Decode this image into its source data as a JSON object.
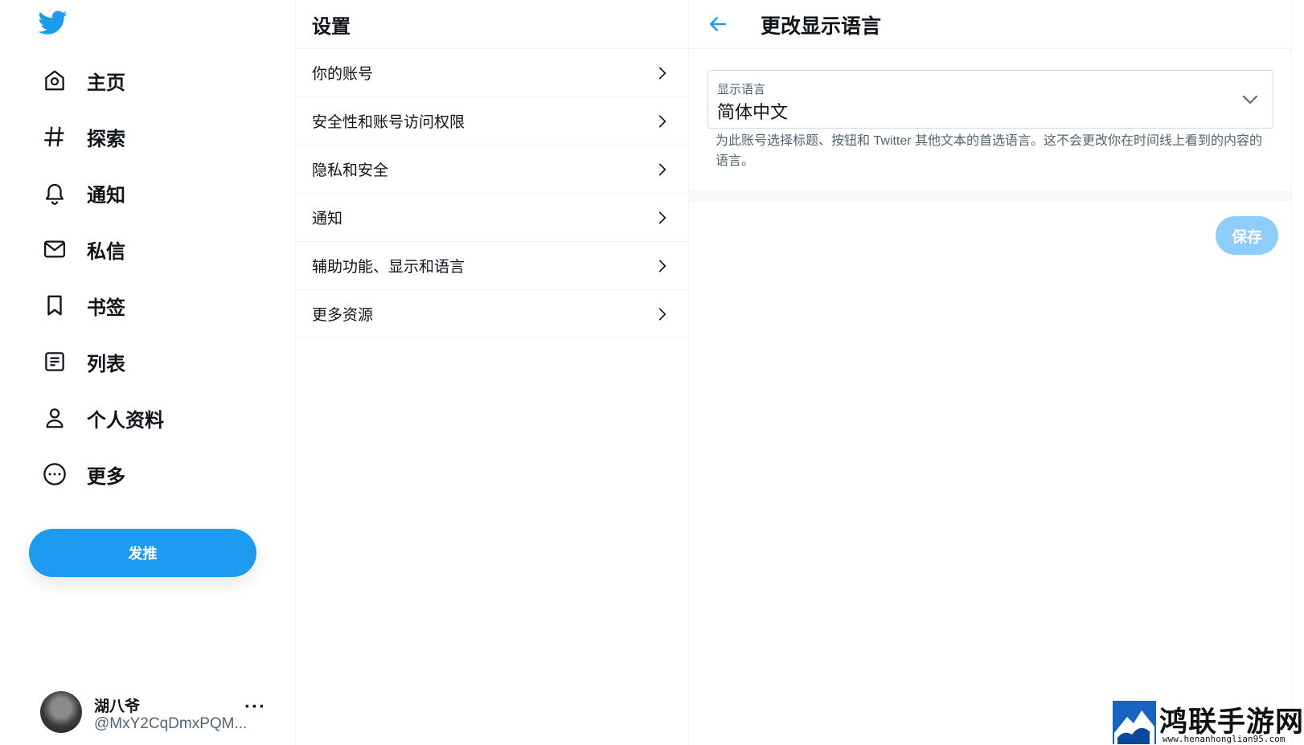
{
  "nav": {
    "items": [
      {
        "label": "主页"
      },
      {
        "label": "探索"
      },
      {
        "label": "通知"
      },
      {
        "label": "私信"
      },
      {
        "label": "书签"
      },
      {
        "label": "列表"
      },
      {
        "label": "个人资料"
      },
      {
        "label": "更多"
      }
    ],
    "tweet_button": "发推"
  },
  "account": {
    "name": "湖八爷",
    "handle": "@MxY2CqDmxPQM...",
    "more": "···"
  },
  "settings": {
    "title": "设置",
    "items": [
      {
        "label": "你的账号"
      },
      {
        "label": "安全性和账号访问权限"
      },
      {
        "label": "隐私和安全"
      },
      {
        "label": "通知"
      },
      {
        "label": "辅助功能、显示和语言"
      },
      {
        "label": "更多资源"
      }
    ]
  },
  "language": {
    "title": "更改显示语言",
    "select_label": "显示语言",
    "select_value": "简体中文",
    "help_text": "为此账号选择标题、按钮和 Twitter 其他文本的首选语言。这不会更改你在时间线上看到的内容的语言。",
    "save_button": "保存"
  },
  "watermark": {
    "text": "鸿联手游网",
    "url": "www.henanhonglian95.com"
  },
  "colors": {
    "accent": "#1d9bf0",
    "disabled_accent": "#8ecdf8",
    "text": "#0f1419",
    "secondary_text": "#536471",
    "border": "#eff3f4"
  },
  "icons": [
    "twitter-bird-icon",
    "home-icon",
    "hashtag-icon",
    "bell-icon",
    "mail-icon",
    "bookmark-icon",
    "list-icon",
    "person-icon",
    "more-circle-icon",
    "chevron-right-icon",
    "back-arrow-icon",
    "chevron-down-icon"
  ]
}
